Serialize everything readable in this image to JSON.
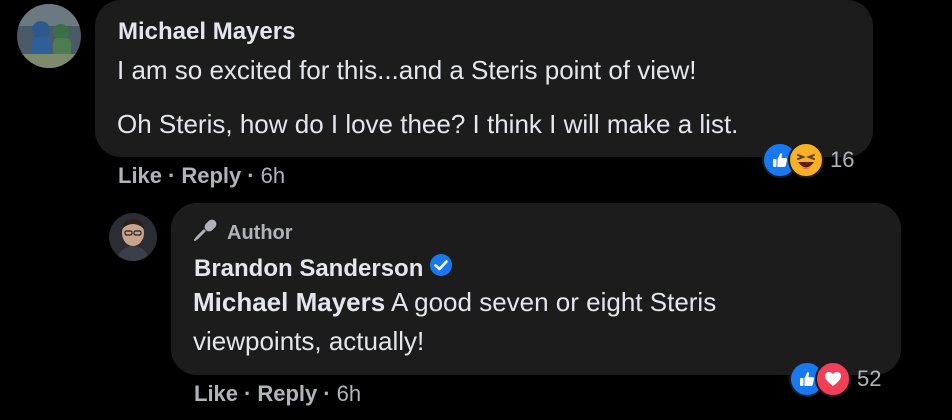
{
  "comment1": {
    "author_name": "Michael Mayers",
    "text_line1": "I am so excited for this...and a Steris point of view!",
    "text_line2": "Oh Steris, how do I love thee? I think I will make a list.",
    "actions": {
      "like": "Like",
      "reply": "Reply",
      "separator": "·",
      "time": "6h"
    },
    "reactions": {
      "icons": [
        "like-icon",
        "haha-icon"
      ],
      "count": "16"
    }
  },
  "reply1": {
    "badge_label": "Author",
    "badge_icon": "microphone-icon",
    "author_name": "Brandon Sanderson",
    "verified_icon": "verified-badge-icon",
    "mention": "Michael Mayers",
    "text_after_mention": " A good seven or eight Steris",
    "text_line2": "viewpoints, actually!",
    "actions": {
      "like": "Like",
      "reply": "Reply",
      "separator": "·",
      "time": "6h"
    },
    "reactions": {
      "icons": [
        "like-icon",
        "love-icon"
      ],
      "count": "52"
    }
  },
  "colors": {
    "background": "#000000",
    "bubble": "#1c1c1d",
    "primary_text": "#e4e6eb",
    "secondary_text": "#b0b3b8",
    "like_blue": "#1877f2",
    "love_red": "#f33e58",
    "haha_yellow": "#f7b125"
  }
}
